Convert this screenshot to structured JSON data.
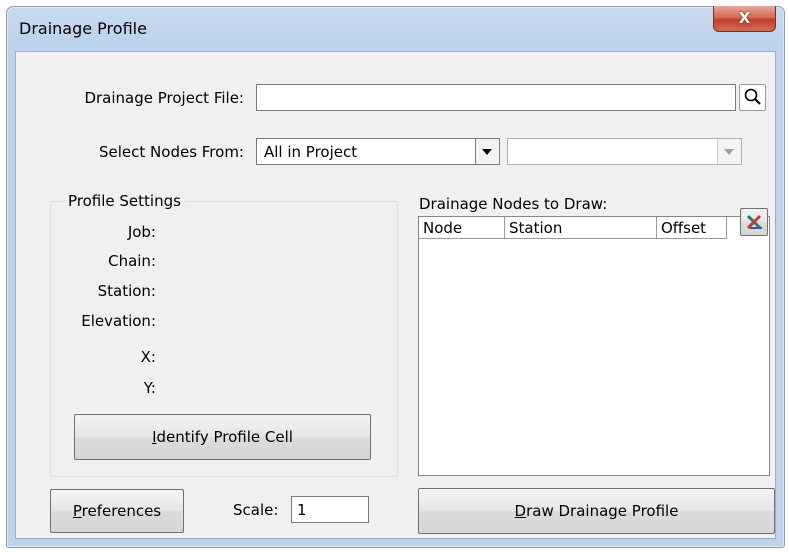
{
  "window": {
    "title": "Drainage Profile",
    "close_glyph": "X"
  },
  "project_file": {
    "label": "Drainage Project File:",
    "value": "",
    "browse_icon": "search-icon"
  },
  "select_nodes": {
    "label": "Select Nodes From:",
    "selected": "All in Project",
    "secondary_selected": ""
  },
  "profile_settings": {
    "title": "Profile Settings",
    "job_label": "Job:",
    "chain_label": "Chain:",
    "station_label": "Station:",
    "elevation_label": "Elevation:",
    "x_label": "X:",
    "y_label": "Y:",
    "identify_button": {
      "mnemonic": "I",
      "rest": "dentify Profile Cell"
    }
  },
  "nodes": {
    "label": "Drainage Nodes to Draw:",
    "columns": [
      "Node",
      "Station",
      "Offset"
    ],
    "rows": [],
    "clear_icon": "clear-list-icon"
  },
  "preferences_button": {
    "mnemonic": "P",
    "rest": "references"
  },
  "scale": {
    "label": "Scale:",
    "value": "1"
  },
  "draw_button": {
    "mnemonic": "D",
    "rest": "raw Drainage Profile"
  }
}
